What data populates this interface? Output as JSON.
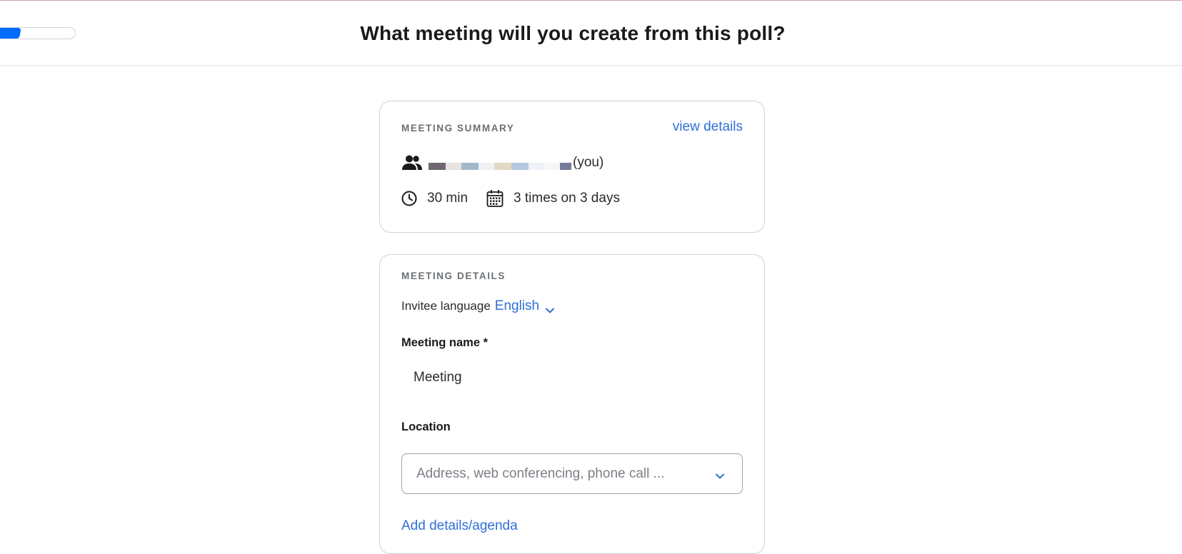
{
  "header": {
    "title": "What meeting will you create from this poll?",
    "progress_fraction": 0.33
  },
  "summary": {
    "section_label": "MEETING SUMMARY",
    "view_details_label": "view details",
    "you_label": "(you)",
    "duration": "30 min",
    "times": "3 times on 3 days",
    "icons": [
      "people-icon",
      "clock-icon",
      "calendar-icon"
    ]
  },
  "details": {
    "section_label": "MEETING DETAILS",
    "invitee_language_label": "Invitee language",
    "invitee_language_value": "English",
    "meeting_name_label": "Meeting name *",
    "meeting_name_value": "Meeting",
    "location_label": "Location",
    "location_placeholder": "Address, web conferencing, phone call ...",
    "add_details_label": "Add details/agenda"
  },
  "colors": {
    "accent_blue": "#006bff",
    "link_blue": "#2f6fd6",
    "label_gray": "#6b7075",
    "border_gray": "#cfd3d8"
  }
}
